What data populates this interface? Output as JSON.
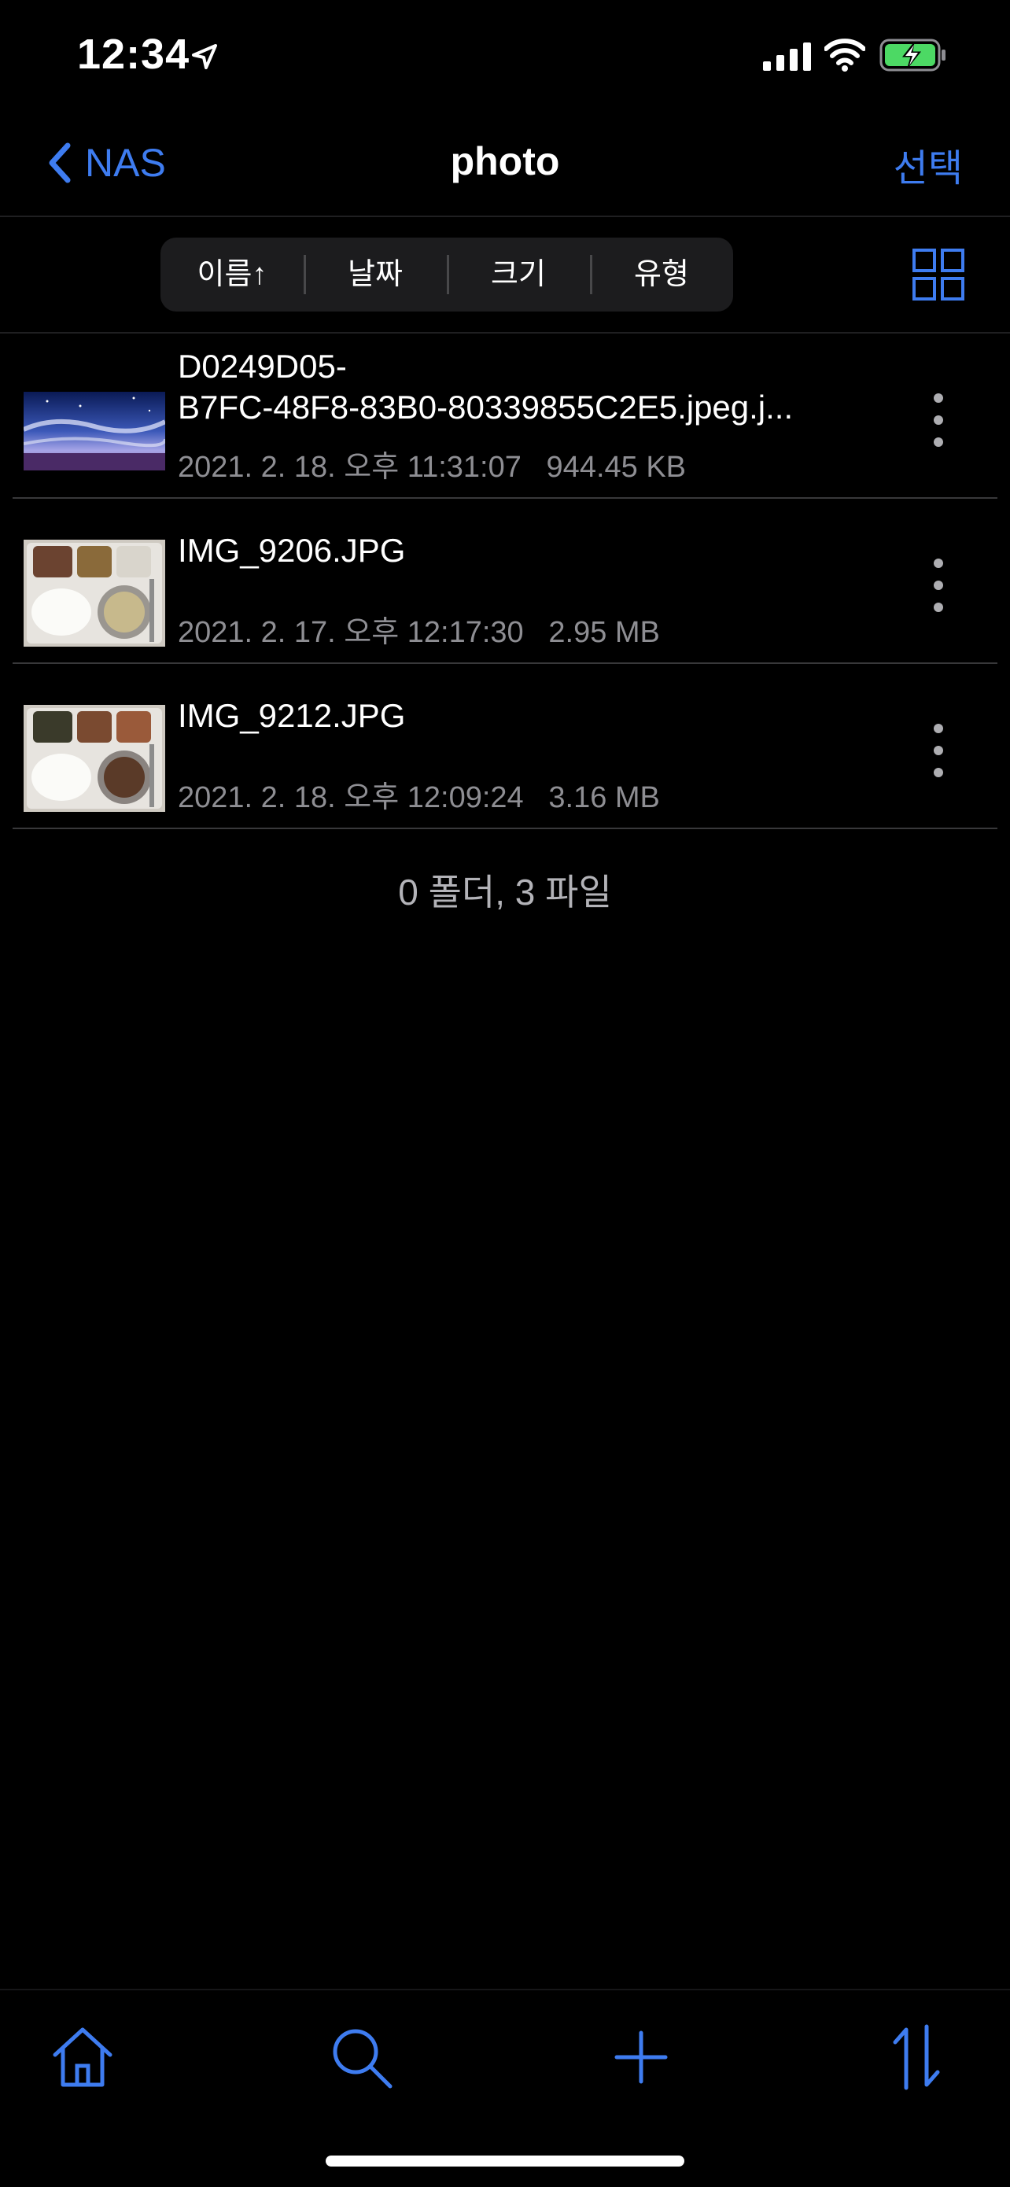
{
  "status_bar": {
    "time": "12:34",
    "icons": [
      "location-arrow-icon",
      "cellular-signal-icon",
      "wifi-icon",
      "battery-charging-icon"
    ]
  },
  "nav": {
    "back_label": "NAS",
    "title": "photo",
    "select_label": "선택",
    "accent_color": "#3e7cf0"
  },
  "sort": {
    "options": [
      "이름↑",
      "날짜",
      "크기",
      "유형"
    ],
    "selected": "이름↑"
  },
  "files": [
    {
      "name": "D0249D05-B7FC-48F8-83B0-80339855C2E5.jpeg.j...",
      "name_line1": "D0249D05-",
      "name_line2": "B7FC-48F8-83B0-80339855C2E5.jpeg.j...",
      "date": "2021. 2. 18. 오후 11:31:07",
      "size": "944.45 KB",
      "thumbnail": "night-sky-landscape-thumbnail"
    },
    {
      "name": "IMG_9206.JPG",
      "date": "2021. 2. 17. 오후 12:17:30",
      "size": "2.95 MB",
      "thumbnail": "meal-tray-thumbnail"
    },
    {
      "name": "IMG_9212.JPG",
      "date": "2021. 2. 18. 오후 12:09:24",
      "size": "3.16 MB",
      "thumbnail": "meal-tray-thumbnail"
    }
  ],
  "summary": "0 폴더, 3 파일",
  "toolbar": {
    "icons": [
      "home-icon",
      "search-icon",
      "plus-icon",
      "sort-arrows-icon"
    ]
  }
}
